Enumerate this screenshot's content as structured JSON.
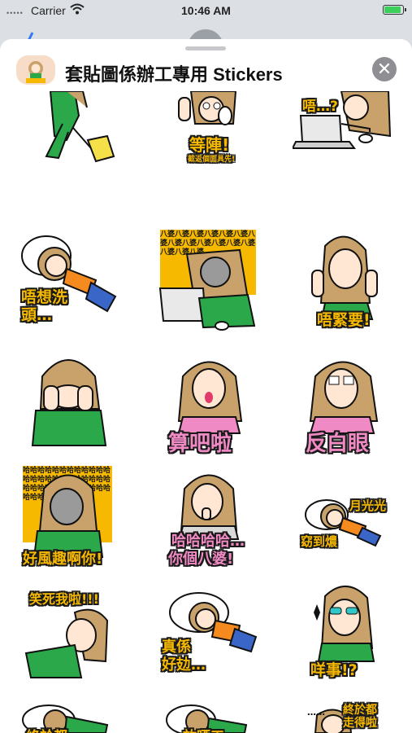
{
  "status": {
    "carrier": "Carrier",
    "time": "10:46 AM"
  },
  "sheet": {
    "title": "套貼圖係辦工專用 Stickers",
    "close_label": "✕"
  },
  "stickers": [
    {
      "caption": ""
    },
    {
      "caption": "等陣!",
      "sub": "截返個面具先!"
    },
    {
      "caption": "唔…?"
    },
    {
      "caption": "唔想洗頭…"
    },
    {
      "caption": "八婆八婆八婆八婆八婆八婆八婆八婆八婆八婆八婆八婆八婆八婆八婆八婆"
    },
    {
      "caption": "唔緊要!"
    },
    {
      "caption": ""
    },
    {
      "caption": "算吧啦"
    },
    {
      "caption": "反白眼"
    },
    {
      "caption": "好風趣啊你!",
      "pattern": "哈哈哈哈哈哈哈哈哈哈哈哈哈哈哈哈哈哈哈哈哈哈哈哈哈哈哈哈哈哈哈哈哈哈哈哈哈哈哈哈"
    },
    {
      "caption": "哈哈哈哈…",
      "sub": "你個八婆!"
    },
    {
      "caption": "月光光",
      "sub": "窈到燶"
    },
    {
      "caption": "笑死我啦!!!"
    },
    {
      "caption": "真係",
      "sub": "好攰…"
    },
    {
      "caption": "咩事!?"
    },
    {
      "caption": "終於都"
    },
    {
      "caption": "放晒工"
    },
    {
      "caption": "……",
      "sub": "終於都走得啦"
    }
  ]
}
